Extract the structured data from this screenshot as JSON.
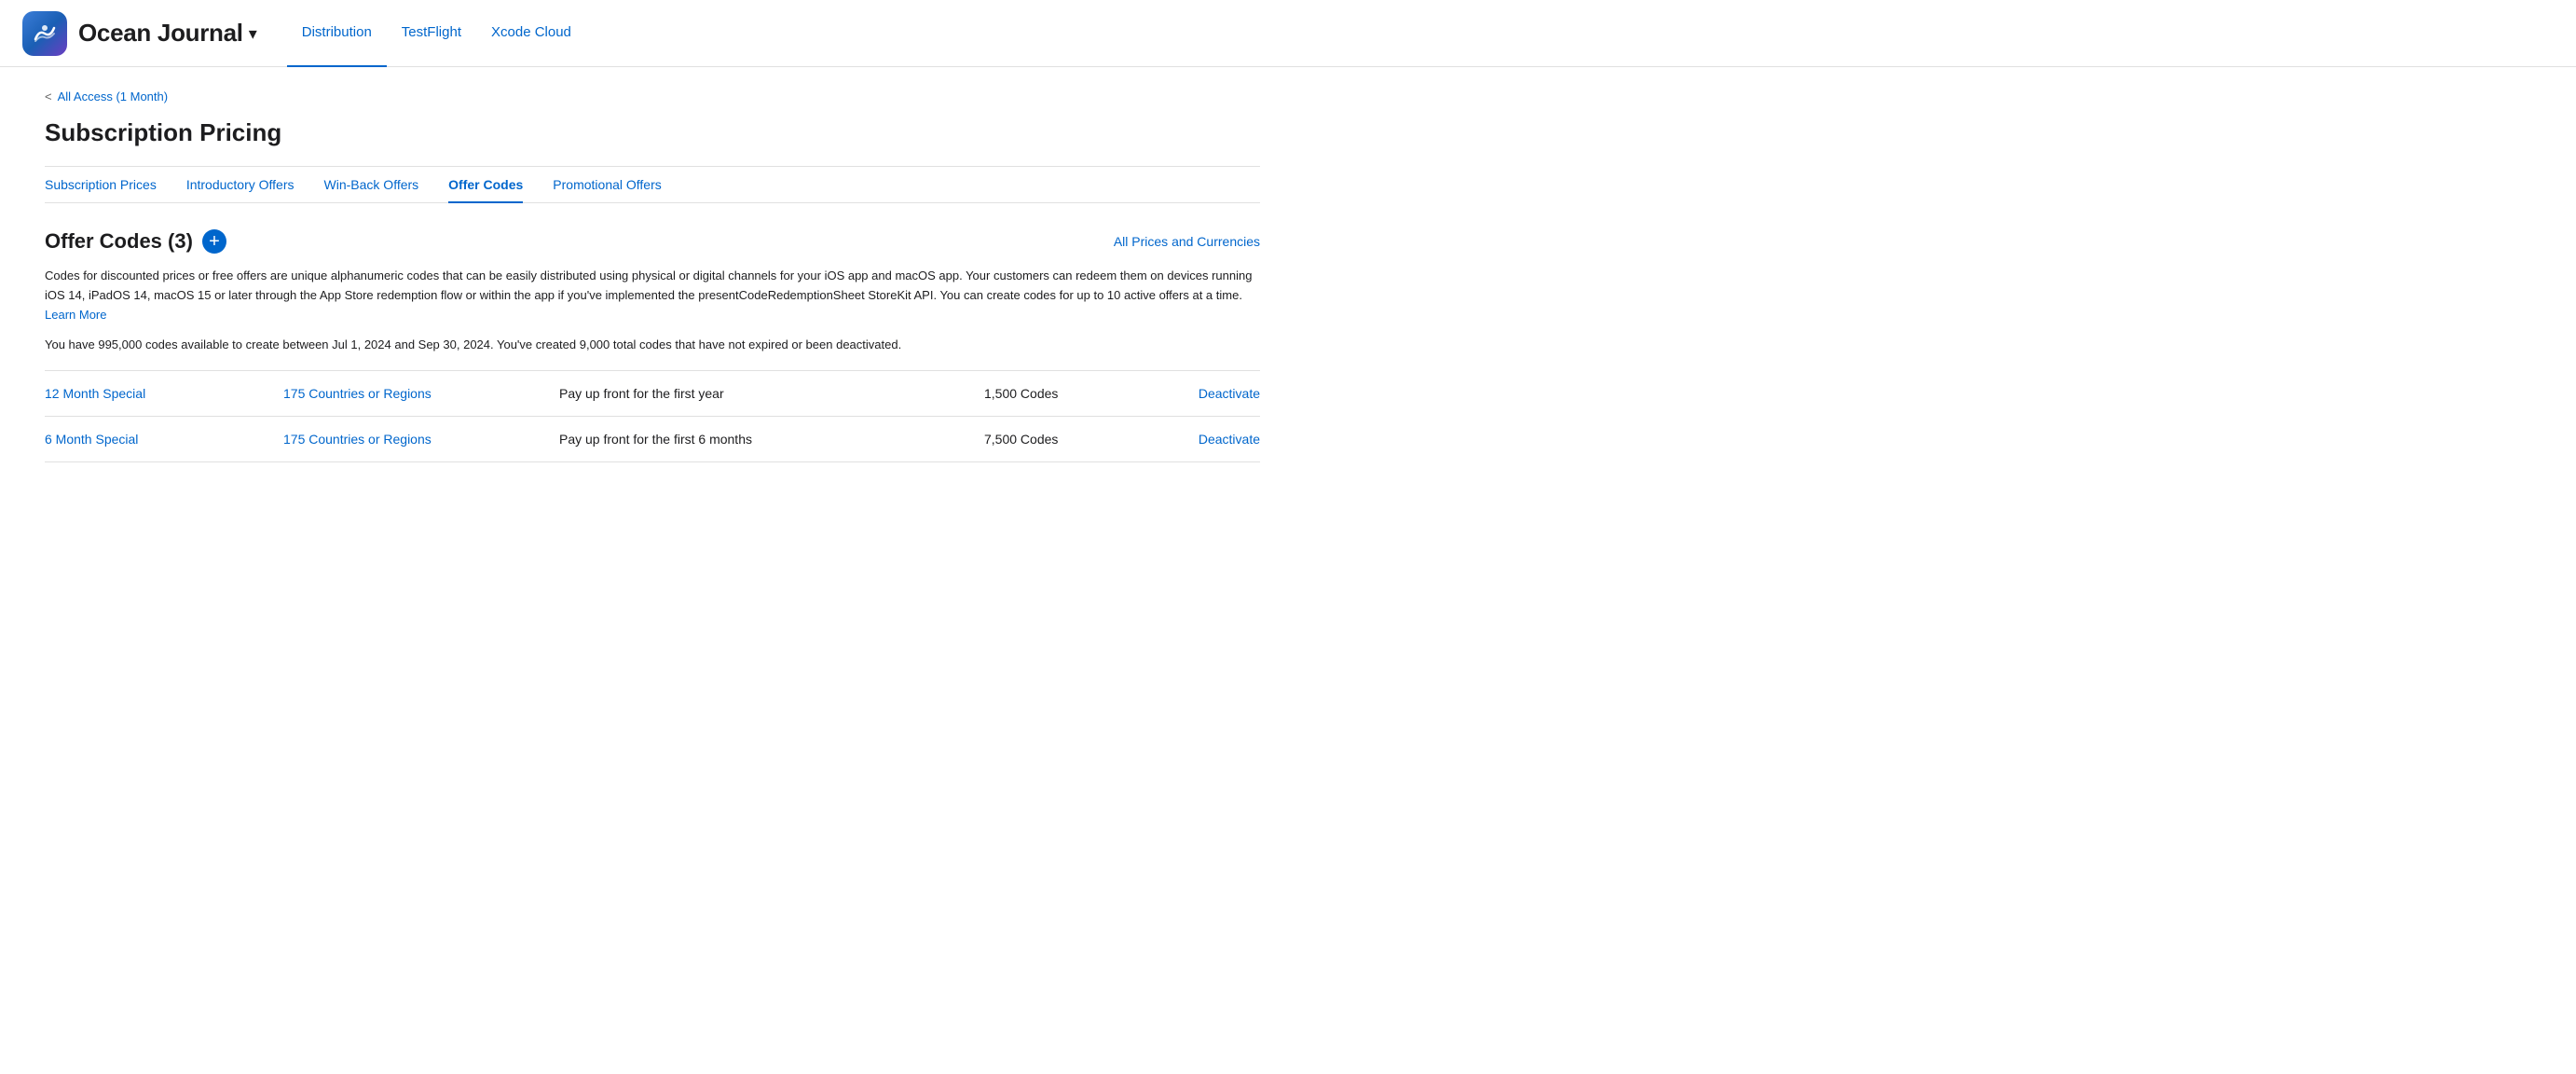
{
  "header": {
    "app_icon_alt": "Ocean Journal app icon",
    "app_name": "Ocean Journal",
    "chevron": "▾",
    "nav_tabs": [
      {
        "id": "distribution",
        "label": "Distribution",
        "active": true
      },
      {
        "id": "testflight",
        "label": "TestFlight",
        "active": false
      },
      {
        "id": "xcode-cloud",
        "label": "Xcode Cloud",
        "active": false
      }
    ]
  },
  "breadcrumb": {
    "chevron": "<",
    "link_label": "All Access (1 Month)"
  },
  "page": {
    "title": "Subscription Pricing"
  },
  "sub_nav": {
    "tabs": [
      {
        "id": "subscription-prices",
        "label": "Subscription Prices",
        "active": false
      },
      {
        "id": "introductory-offers",
        "label": "Introductory Offers",
        "active": false
      },
      {
        "id": "win-back-offers",
        "label": "Win-Back Offers",
        "active": false
      },
      {
        "id": "offer-codes",
        "label": "Offer Codes",
        "active": true
      },
      {
        "id": "promotional-offers",
        "label": "Promotional Offers",
        "active": false
      }
    ]
  },
  "section": {
    "title": "Offer Codes (3)",
    "add_button_label": "+",
    "all_prices_link": "All Prices and Currencies",
    "description": "Codes for discounted prices or free offers are unique alphanumeric codes that can be easily distributed using physical or digital channels for your iOS app and macOS app. Your customers can redeem them on devices running iOS 14, iPadOS 14, macOS 15 or later through the App Store redemption flow or within the app if you've implemented the presentCodeRedemptionSheet StoreKit API. You can create codes for up to 10 active offers at a time.",
    "learn_more_label": "Learn More",
    "availability_text": "You have 995,000 codes available to create between Jul 1, 2024 and Sep 30, 2024. You've created 9,000 total codes that have not expired or been deactivated."
  },
  "offers": [
    {
      "name": "12 Month Special",
      "regions": "175 Countries or Regions",
      "description": "Pay up front for the first year",
      "codes": "1,500 Codes",
      "action": "Deactivate"
    },
    {
      "name": "6 Month Special",
      "regions": "175 Countries or Regions",
      "description": "Pay up front for the first 6 months",
      "codes": "7,500 Codes",
      "action": "Deactivate"
    }
  ]
}
